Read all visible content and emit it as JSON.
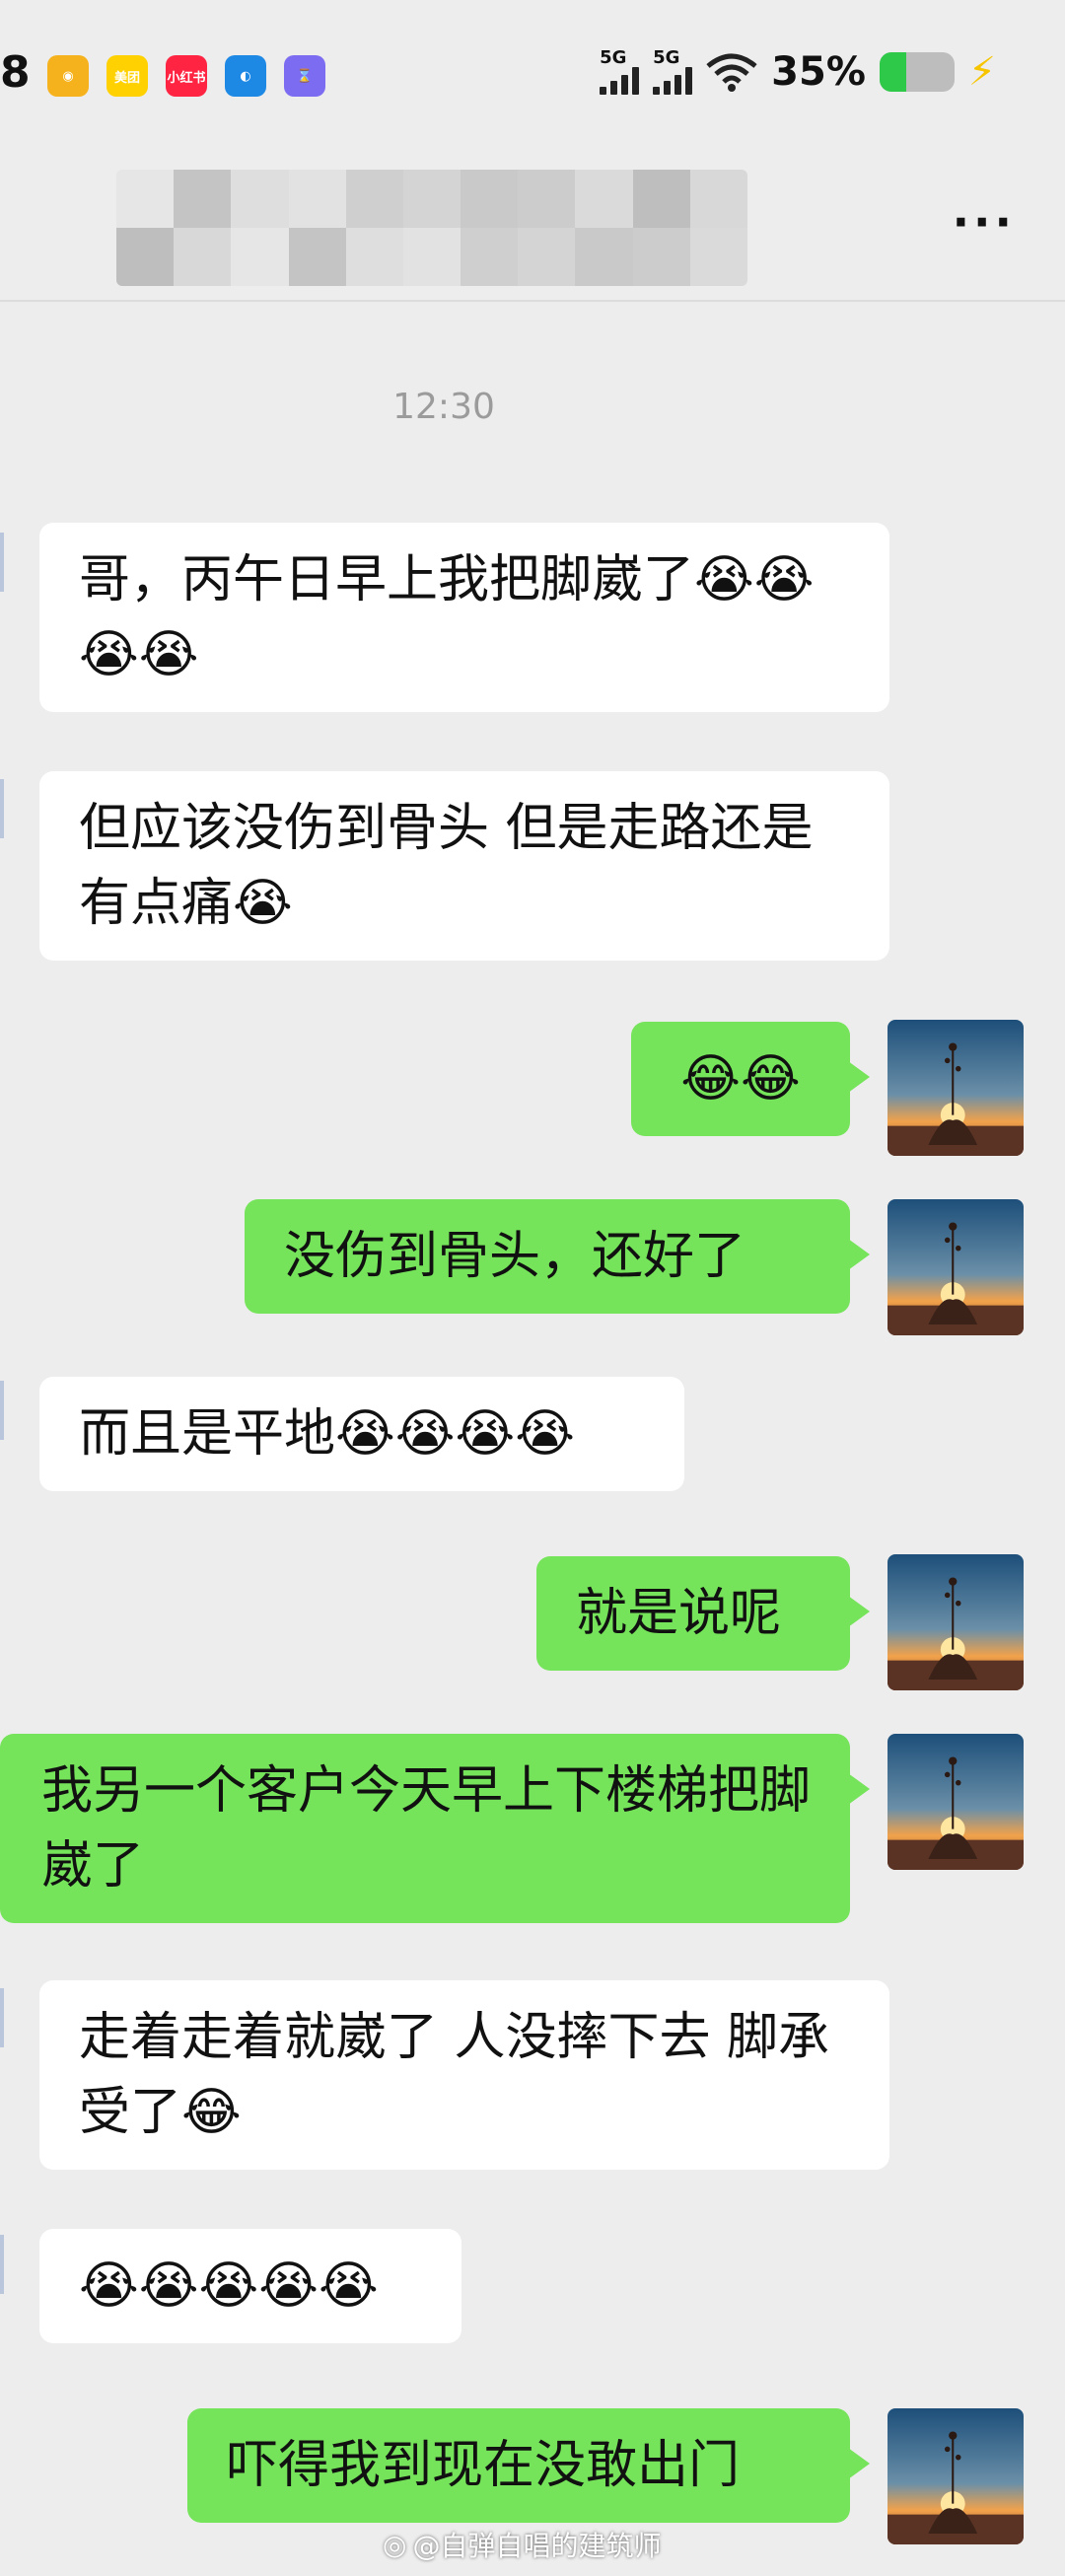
{
  "status_bar": {
    "time": "8",
    "apps": [
      {
        "name": "weibo-app-icon",
        "label": "◉",
        "color": "#f5b21c"
      },
      {
        "name": "meituan-app-icon",
        "label": "美团",
        "color": "#ffd100"
      },
      {
        "name": "xiaohongshu-app-icon",
        "label": "小红书",
        "color": "#ff2442"
      },
      {
        "name": "ctrip-app-icon",
        "label": "◐",
        "color": "#1e88e5"
      },
      {
        "name": "timer-app-icon",
        "label": "⌛",
        "color": "#7c6cf2"
      }
    ],
    "signal1_label": "5G",
    "signal2_label": "5G",
    "battery_percent": "35%",
    "battery_level": 0.35
  },
  "header": {
    "title_redacted": true,
    "more_label": "···"
  },
  "timestamp": "12:30",
  "messages": [
    {
      "side": "in",
      "text": "哥，丙午日早上我把脚崴了😭😭😭😭"
    },
    {
      "side": "in",
      "text": "但应该没伤到骨头 但是走路还是有点痛😭"
    },
    {
      "side": "out",
      "text": "😂😂"
    },
    {
      "side": "out",
      "text": "没伤到骨头，还好了"
    },
    {
      "side": "in",
      "text": "而且是平地😭😭😭😭"
    },
    {
      "side": "out",
      "text": "就是说呢"
    },
    {
      "side": "out",
      "text": "我另一个客户今天早上下楼梯把脚崴了"
    },
    {
      "side": "in",
      "text": "走着走着就崴了 人没摔下去 脚承受了😂"
    },
    {
      "side": "in",
      "text": "😭😭😭😭😭"
    },
    {
      "side": "out",
      "text": "吓得我到现在没敢出门"
    }
  ],
  "watermark": "@自弹自唱的建筑师",
  "colors": {
    "outgoing_bubble": "#75e45a",
    "incoming_bubble": "#ffffff",
    "background": "#ededed"
  }
}
